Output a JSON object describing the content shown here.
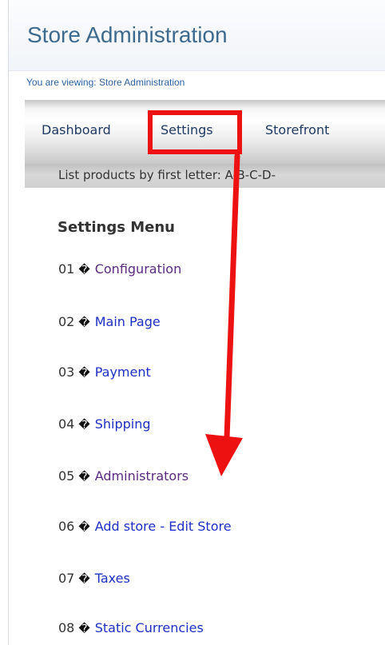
{
  "page": {
    "title": "Store Administration",
    "breadcrumb": "You are viewing: Store Administration"
  },
  "nav": {
    "tabs": [
      {
        "label": "Dashboard"
      },
      {
        "label": "Settings"
      },
      {
        "label": "Storefront"
      }
    ],
    "letter_filter": {
      "label": "List products by first letter:",
      "letters": "A-B-C-D-"
    }
  },
  "settings_menu": {
    "heading": "Settings Menu",
    "separator": "�",
    "items": [
      {
        "num": "01",
        "label": "Configuration",
        "state": "visited"
      },
      {
        "num": "02",
        "label": "Main Page",
        "state": "link"
      },
      {
        "num": "03",
        "label": "Payment",
        "state": "link"
      },
      {
        "num": "04",
        "label": "Shipping",
        "state": "link"
      },
      {
        "num": "05",
        "label": "Administrators",
        "state": "visited"
      },
      {
        "num": "06",
        "label": "Add store - Edit Store",
        "state": "link"
      },
      {
        "num": "07",
        "label": "Taxes",
        "state": "link"
      },
      {
        "num": "08",
        "label": "Static Currencies",
        "state": "link"
      }
    ]
  },
  "colors": {
    "annotation": "#ee1111",
    "title": "#3d6b8f",
    "visited_link": "#5a2a82",
    "link": "#1d2fc4"
  }
}
